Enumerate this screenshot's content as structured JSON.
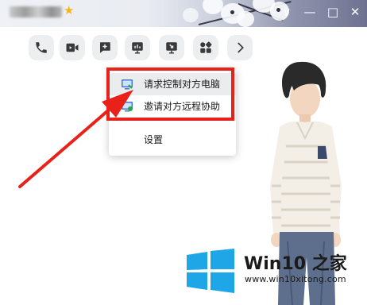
{
  "titlebar": {
    "username_blurred": true,
    "vip_icon": "star-icon",
    "controls": {
      "collapse_glyph": "∨",
      "minimize_glyph": "—",
      "maximize_glyph": "□",
      "close_glyph": "✕"
    }
  },
  "toolbar": {
    "buttons": [
      {
        "icon": "phone-icon"
      },
      {
        "icon": "video-icon"
      },
      {
        "icon": "add-chat-icon"
      },
      {
        "icon": "presentation-icon"
      },
      {
        "icon": "screen-share-icon"
      },
      {
        "icon": "apps-icon"
      },
      {
        "icon": "chevron-right-icon"
      }
    ],
    "icon_color": "#3a3a3a"
  },
  "menu": {
    "items": [
      {
        "label": "请求控制对方电脑",
        "icon": "remote-control-icon"
      },
      {
        "label": "邀请对方远程协助",
        "icon": "remote-assist-icon"
      },
      {
        "label": "设置",
        "icon": ""
      }
    ]
  },
  "annotation": {
    "color": "#e8221b"
  },
  "watermark": {
    "brand_prefix": "Win10",
    "brand_suffix": "之家",
    "url": "www.win10xitong.com",
    "logo_color": "#1ea6e6"
  }
}
